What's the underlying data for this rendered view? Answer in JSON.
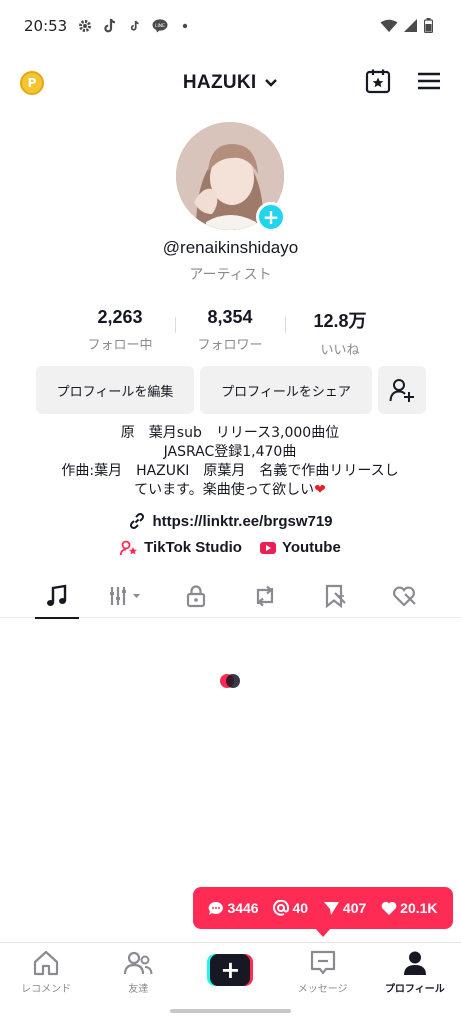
{
  "status_bar": {
    "time": "20:53",
    "left_icons": [
      "gear-icon",
      "tiktok-icon",
      "tiktok-small-icon",
      "line-icon",
      "dot-icon"
    ],
    "right_icons": [
      "wifi-icon",
      "signal-icon",
      "battery-icon"
    ]
  },
  "header": {
    "coin_icon": "coin-icon",
    "username": "HAZUKI",
    "dropdown_icon": "chevron-down-icon",
    "right_icons": [
      "calendar-star-icon",
      "menu-icon"
    ]
  },
  "profile": {
    "avatar_icon": "avatar",
    "add_badge": "+",
    "handle": "@renaikinshidayo",
    "role": "アーティスト"
  },
  "stats": [
    {
      "value": "2,263",
      "label": "フォロー中"
    },
    {
      "value": "8,354",
      "label": "フォロワー"
    },
    {
      "value": "12.8万",
      "label": "いいね"
    }
  ],
  "buttons": {
    "edit_profile": "プロフィールを編集",
    "share_profile": "プロフィールをシェア",
    "add_friend_icon": "add-user-icon"
  },
  "bio": {
    "line1": "原　葉月sub　リリース3,000曲位",
    "line2": "JASRAC登録1,470曲",
    "line3": "作曲:葉月　HAZUKI　原葉月　名義で作曲リリースし",
    "line4": "ています。楽曲使って欲しい",
    "heart": "❤"
  },
  "link": {
    "url": "https://linktr.ee/brgsw719",
    "icon": "link-icon"
  },
  "extra_links": {
    "studio": "TikTok Studio",
    "youtube": "Youtube"
  },
  "tabs": [
    {
      "icon": "music-note-icon",
      "active": true
    },
    {
      "icon": "equalizer-dropdown-icon",
      "active": false
    },
    {
      "icon": "lock-icon",
      "active": false
    },
    {
      "icon": "repost-icon",
      "active": false
    },
    {
      "icon": "favorites-icon",
      "active": false
    },
    {
      "icon": "liked-hidden-icon",
      "active": false
    }
  ],
  "notifications": {
    "comments": "3446",
    "mentions": "40",
    "shares": "407",
    "likes": "20.1K"
  },
  "bottom_nav": {
    "home": "レコメンド",
    "friends": "友達",
    "create": "+",
    "messages": "メッセージ",
    "profile": "プロフィール"
  },
  "colors": {
    "accent": "#fe2c55",
    "cyan": "#20d5ec",
    "text": "#161823",
    "muted": "#8a8b91"
  }
}
